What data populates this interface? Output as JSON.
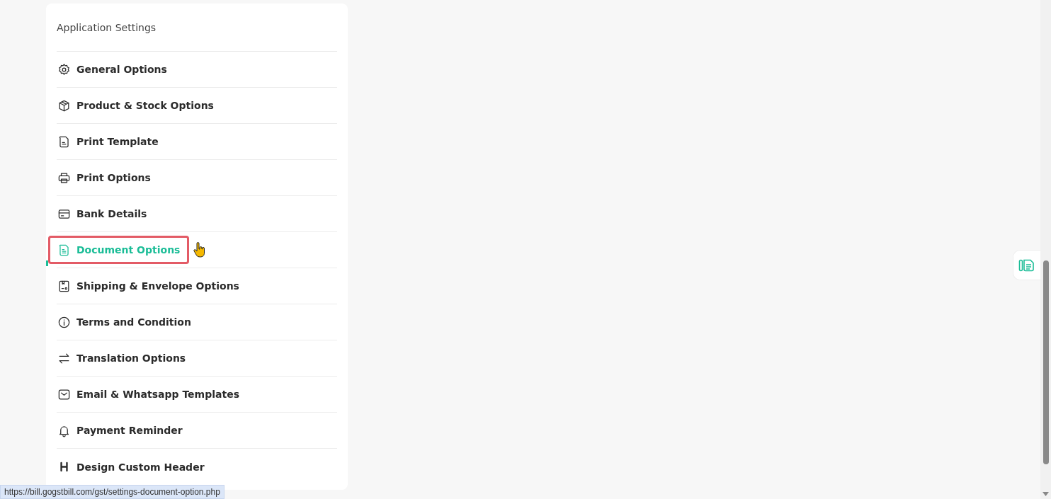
{
  "settings_panel": {
    "title": "Application Settings",
    "items": [
      {
        "label": "General Options",
        "selected": false
      },
      {
        "label": "Product & Stock Options",
        "selected": false
      },
      {
        "label": "Print Template",
        "selected": false
      },
      {
        "label": "Print Options",
        "selected": false
      },
      {
        "label": "Bank Details",
        "selected": false
      },
      {
        "label": "Document Options",
        "selected": true
      },
      {
        "label": "Shipping & Envelope Options",
        "selected": false
      },
      {
        "label": "Terms and Condition",
        "selected": false
      },
      {
        "label": "Translation Options",
        "selected": false
      },
      {
        "label": "Email & Whatsapp Templates",
        "selected": false
      },
      {
        "label": "Payment Reminder",
        "selected": false
      },
      {
        "label": "Design Custom Header",
        "selected": false
      }
    ]
  },
  "status_bar": {
    "url": "https://bill.gogstbill.com/gst/settings-document-option.php"
  }
}
